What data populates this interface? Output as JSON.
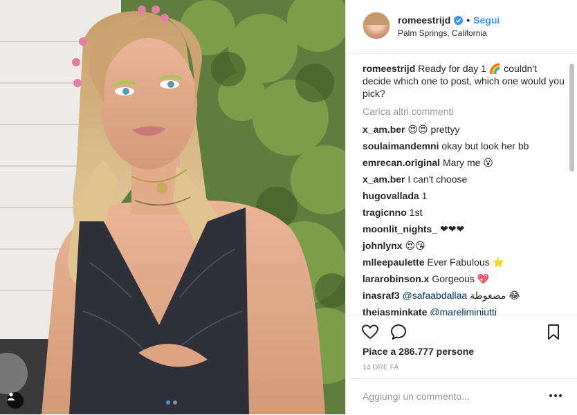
{
  "post": {
    "username": "romeestrijd",
    "follow_label": "Segui",
    "location": "Palm Springs, California",
    "caption_user": "romeestrijd",
    "caption_text": "Ready for day 1 🌈 couldn't decide which one to post, which one would you pick?",
    "load_more": "Carica altri commenti",
    "comments": [
      {
        "user": "x_am.ber",
        "text": "😍😍 prettyy"
      },
      {
        "user": "soulaimandemni",
        "text": "okay but look her bb"
      },
      {
        "user": "emrecan.original",
        "text": "Mary me 😮"
      },
      {
        "user": "x_am.ber",
        "text": "I can't choose"
      },
      {
        "user": "hugovallada",
        "text": "1"
      },
      {
        "user": "tragicnno",
        "text": "1st"
      },
      {
        "user": "moonlit_nights_",
        "text": "❤❤❤"
      },
      {
        "user": "johnlynx",
        "text": "😍😘"
      },
      {
        "user": "mlleepaulette",
        "text": "Ever Fabulous ⭐"
      },
      {
        "user": "lararobinson.x",
        "text": "Gorgeous 💖"
      },
      {
        "user": "inasraf3",
        "mention": "@safaabdallaa",
        "text": "مضغوطة 😂"
      },
      {
        "user": "thejasminkate",
        "mention": "@mareliminiutti",
        "text": ""
      }
    ],
    "likes": "Piace a 286.777 persone",
    "time": "14 ORE FA",
    "comment_placeholder": "Aggiungi un commento...",
    "carousel_index": 1,
    "carousel_total": 2
  },
  "colors": {
    "accent": "#3897f0",
    "text": "#262626",
    "muted": "#999999",
    "border": "#efefef"
  }
}
